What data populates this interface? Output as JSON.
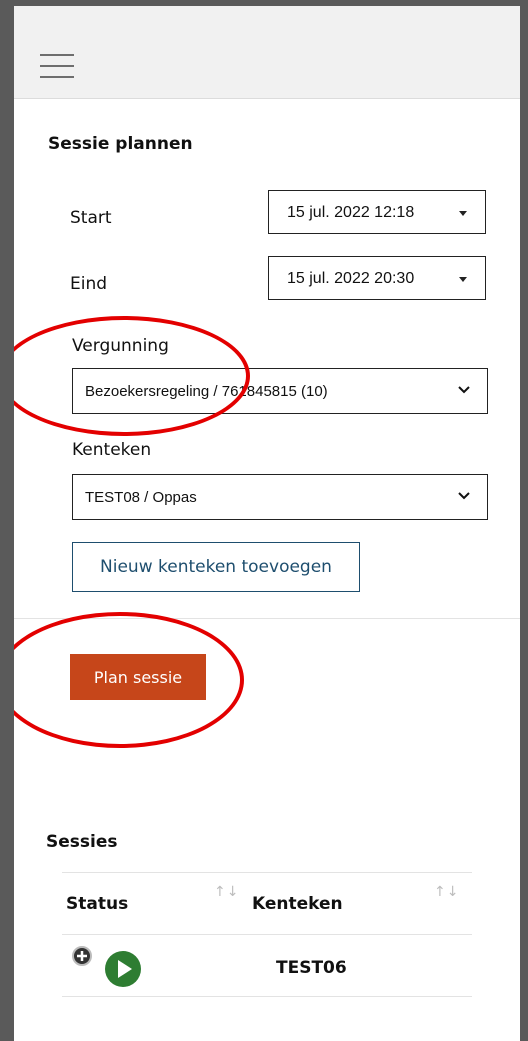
{
  "header": {
    "menu_icon": "hamburger-menu-icon"
  },
  "form": {
    "title": "Sessie plannen",
    "start_label": "Start",
    "start_value": "15 jul. 2022 12:18",
    "end_label": "Eind",
    "end_value": "15 jul. 2022 20:30",
    "vergunning_label": "Vergunning",
    "vergunning_value": "Bezoekersregeling / 761845815 (10)",
    "kenteken_label": "Kenteken",
    "kenteken_value": "TEST08 / Oppas",
    "add_kenteken_button": "Nieuw kenteken toevoegen",
    "plan_button": "Plan sessie"
  },
  "sessions": {
    "title": "Sessies",
    "columns": [
      "Status",
      "Kenteken"
    ],
    "sort_glyph": "↑↓",
    "rows": [
      {
        "kenteken": "TEST06",
        "status_icon": "play-icon",
        "expand_icon": "plus-circle-icon"
      }
    ]
  },
  "colors": {
    "accent_button": "#c6461a",
    "link_border": "#1e4e6e",
    "annotation_red": "#e30000",
    "status_green": "#2e7d32"
  }
}
